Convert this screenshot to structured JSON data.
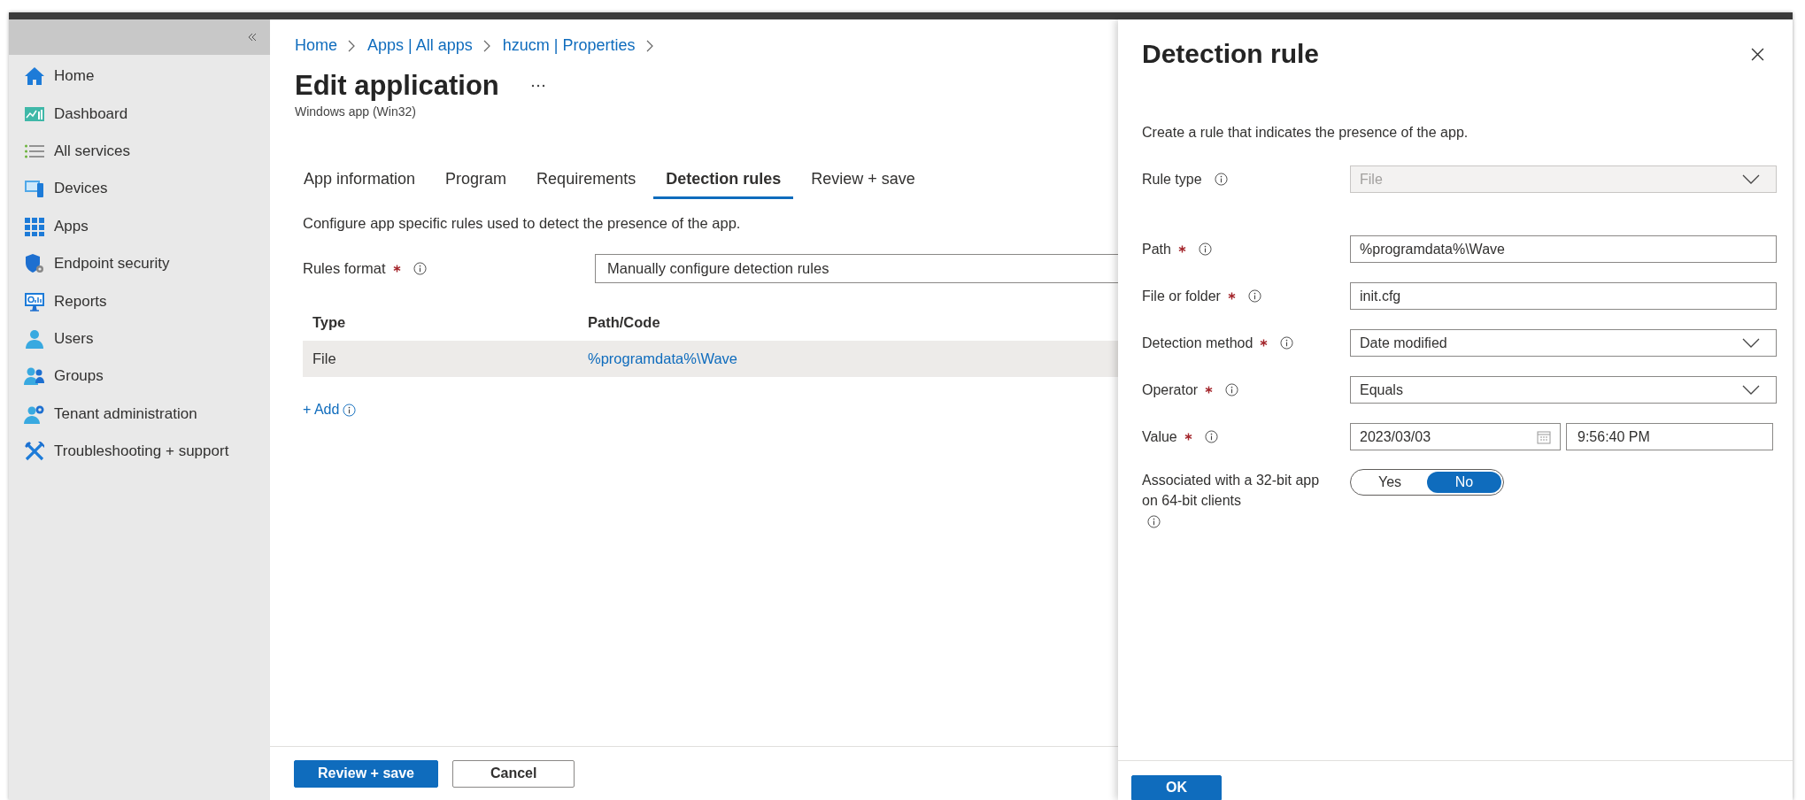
{
  "sidebar": {
    "items": [
      {
        "label": "Home",
        "selected": false
      },
      {
        "label": "Dashboard",
        "selected": false
      },
      {
        "label": "All services",
        "selected": false
      },
      {
        "label": "Devices",
        "selected": false
      },
      {
        "label": "Apps",
        "selected": false
      },
      {
        "label": "Endpoint security",
        "selected": false
      },
      {
        "label": "Reports",
        "selected": false
      },
      {
        "label": "Users",
        "selected": false
      },
      {
        "label": "Groups",
        "selected": false
      },
      {
        "label": "Tenant administration",
        "selected": false
      },
      {
        "label": "Troubleshooting + support",
        "selected": false
      }
    ]
  },
  "breadcrumb": [
    "Home",
    "Apps | All apps",
    "hzucm | Properties"
  ],
  "page": {
    "title": "Edit application",
    "subtitle": "Windows app (Win32)"
  },
  "tabs": [
    {
      "label": "App information",
      "selected": false
    },
    {
      "label": "Program",
      "selected": false
    },
    {
      "label": "Requirements",
      "selected": false
    },
    {
      "label": "Detection rules",
      "selected": true
    },
    {
      "label": "Review + save",
      "selected": false
    }
  ],
  "description": "Configure app specific rules used to detect the presence of the app.",
  "rules_format": {
    "label": "Rules format",
    "required": true,
    "value": "Manually configure detection rules"
  },
  "table": {
    "columns": [
      "Type",
      "Path/Code"
    ],
    "rows": [
      {
        "cells": [
          "File",
          "%programdata%\\Wave"
        ],
        "selected": true
      }
    ]
  },
  "add_link": "+ Add",
  "footer_buttons": [
    {
      "label": "Review + save",
      "kind": "primary"
    },
    {
      "label": "Cancel",
      "kind": "secondary"
    }
  ],
  "panel": {
    "title": "Detection rule",
    "description": "Create a rule that indicates the presence of the app.",
    "fields": [
      {
        "kind": "select",
        "label": "Rule type",
        "required": false,
        "value": "File",
        "disabled": true
      },
      {
        "kind": "text",
        "label": "Path",
        "required": true,
        "value": "%programdata%\\Wave"
      },
      {
        "kind": "text",
        "label": "File or folder",
        "required": true,
        "value": "init.cfg"
      },
      {
        "kind": "select",
        "label": "Detection method",
        "required": true,
        "value": "Date modified",
        "disabled": false
      },
      {
        "kind": "select",
        "label": "Operator",
        "required": true,
        "value": "Equals",
        "disabled": false
      },
      {
        "kind": "datetime",
        "label": "Value",
        "required": true,
        "date": "2023/03/03",
        "time": "9:56:40 PM"
      },
      {
        "kind": "toggle",
        "label": "Associated with a 32-bit app on 64-bit clients",
        "required": false,
        "options": [
          {
            "label": "Yes",
            "selected": false
          },
          {
            "label": "No",
            "selected": true
          }
        ]
      }
    ],
    "buttons": [
      {
        "label": "OK",
        "kind": "primary"
      }
    ]
  }
}
